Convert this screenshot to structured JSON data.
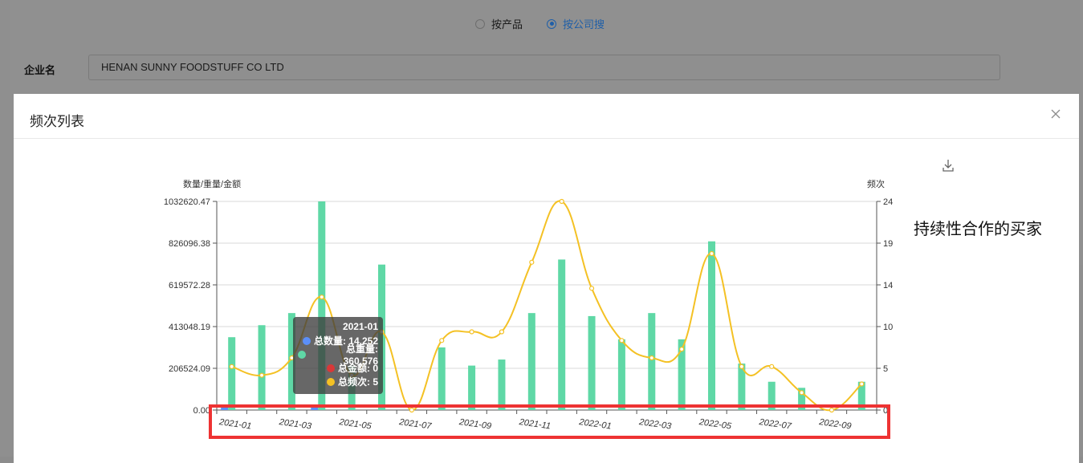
{
  "search": {
    "options": [
      {
        "label": "按产品",
        "selected": false
      },
      {
        "label": "按公司搜",
        "selected": true
      }
    ],
    "company_label": "企业名",
    "company_value": "HENAN SUNNY FOODSTUFF CO LTD"
  },
  "modal": {
    "title": "频次列表",
    "side_note": "持续性合作的买家"
  },
  "tooltip": {
    "title": "2021-01",
    "rows": [
      {
        "label": "总数量: 14,252",
        "color": "#5b8ff9"
      },
      {
        "label": "总重量: 360,576",
        "color": "#5fd8a6"
      },
      {
        "label": "总金额: 0",
        "color": "#d93838"
      },
      {
        "label": "总频次: 5",
        "color": "#f4c124"
      }
    ]
  },
  "chart_data": {
    "type": "bar",
    "left_axis_name": "数量/重量/金额",
    "right_axis_name": "频次",
    "left_ticks": [
      "1032620.47",
      "826096.38",
      "619572.28",
      "413048.19",
      "206524.09",
      "0.00"
    ],
    "right_ticks": [
      "24",
      "19",
      "14",
      "10",
      "5",
      "0"
    ],
    "ylim_left": [
      0,
      1032620.47
    ],
    "ylim_right": [
      0,
      24
    ],
    "categories": [
      "2021-01",
      "2021-02",
      "2021-03",
      "2021-04",
      "2021-05",
      "2021-06",
      "2021-07",
      "2021-08",
      "2021-09",
      "2021-10",
      "2021-11",
      "2021-12",
      "2022-01",
      "2022-02",
      "2022-03",
      "2022-04",
      "2022-05",
      "2022-06",
      "2022-07",
      "2022-08",
      "2022-09",
      "2022-10"
    ],
    "x_tick_labels": [
      "2021-01",
      "2021-03",
      "2021-05",
      "2021-07",
      "2021-09",
      "2021-11",
      "2022-01",
      "2022-03",
      "2022-05",
      "2022-07",
      "2022-09"
    ],
    "series": [
      {
        "name": "总数量",
        "kind": "bar",
        "axis": "left",
        "color": "#5b8ff9",
        "values": [
          14252,
          0,
          0,
          12000,
          0,
          0,
          0,
          0,
          0,
          0,
          0,
          0,
          0,
          0,
          0,
          0,
          0,
          0,
          0,
          0,
          0,
          0
        ]
      },
      {
        "name": "总重量",
        "kind": "bar",
        "axis": "left",
        "color": "#5fd8a6",
        "values": [
          360576,
          420000,
          480000,
          1032620,
          220000,
          720000,
          0,
          310000,
          220000,
          250000,
          480000,
          745000,
          465000,
          350000,
          480000,
          350000,
          835000,
          230000,
          140000,
          110000,
          0,
          140000
        ]
      },
      {
        "name": "总金额",
        "kind": "bar",
        "axis": "left",
        "color": "#d93838",
        "values": [
          0,
          0,
          0,
          0,
          0,
          0,
          0,
          0,
          0,
          0,
          0,
          0,
          0,
          0,
          0,
          0,
          0,
          0,
          0,
          0,
          0,
          0
        ]
      },
      {
        "name": "总频次",
        "kind": "line",
        "axis": "right",
        "color": "#f4c124",
        "values": [
          5,
          4,
          6,
          13,
          4,
          9,
          0,
          8,
          9,
          9,
          17,
          24,
          14,
          8,
          6,
          7,
          18,
          5,
          5,
          2,
          0,
          3
        ]
      }
    ],
    "grid": true
  }
}
